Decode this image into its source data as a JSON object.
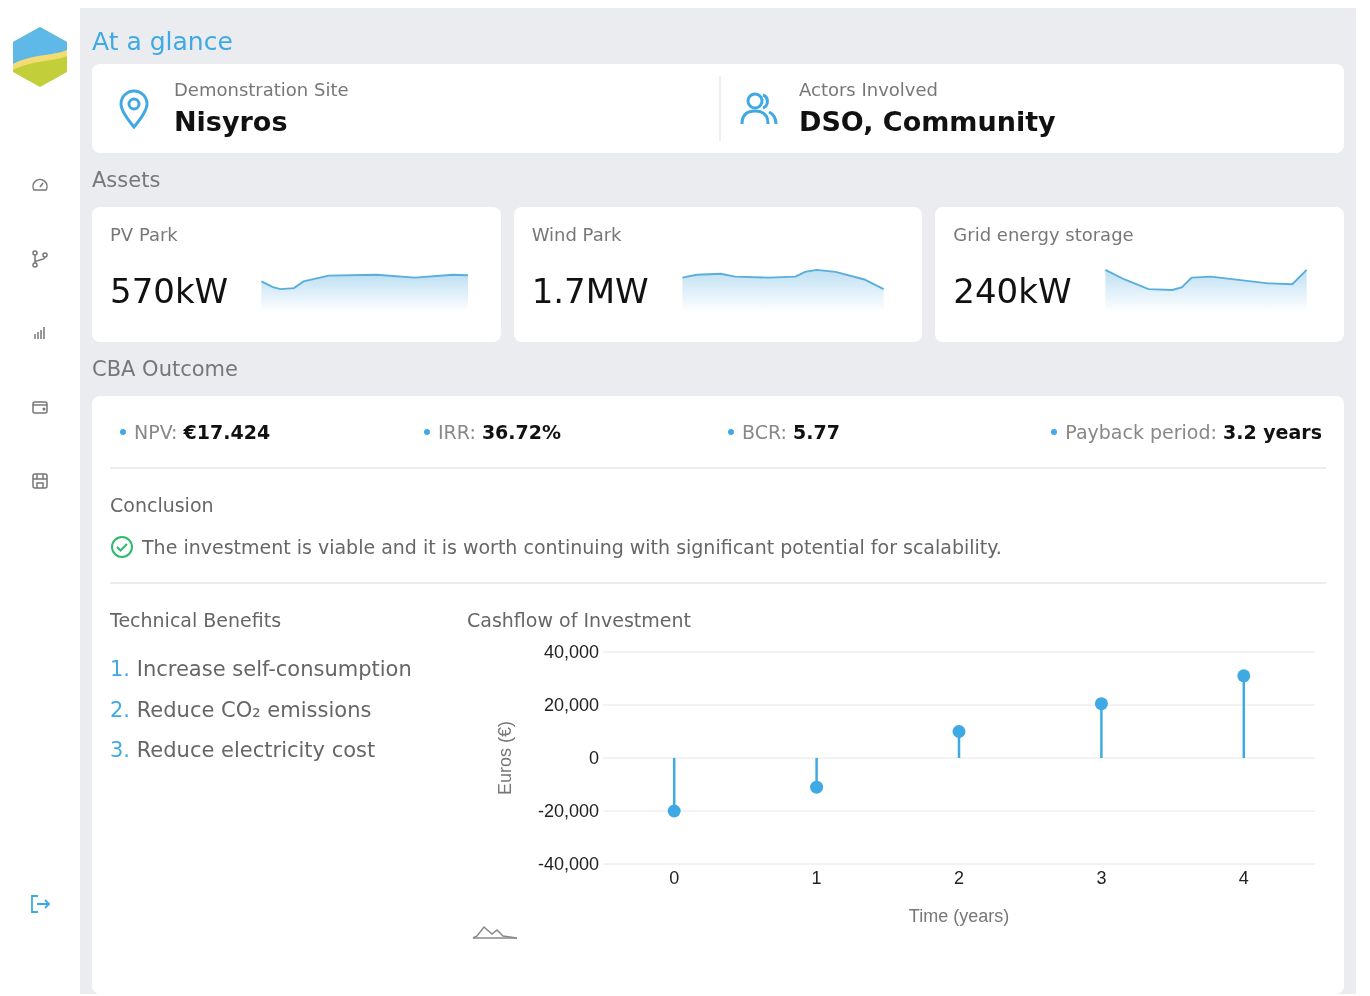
{
  "title": "At a glance",
  "summary": [
    {
      "kind": "location",
      "label": "Demonstration Site",
      "value": "Nisyros"
    },
    {
      "kind": "people",
      "label": "Actors Involved",
      "value": "DSO, Community"
    }
  ],
  "assets": {
    "heading": "Assets",
    "items": [
      {
        "label": "PV Park",
        "value": "570kW"
      },
      {
        "label": "Wind Park",
        "value": "1.7MW"
      },
      {
        "label": "Grid energy storage",
        "value": "240kW"
      }
    ]
  },
  "cba": {
    "heading": "CBA Outcome",
    "metrics": [
      {
        "label": "NPV:",
        "value": "€17.424"
      },
      {
        "label": "IRR:",
        "value": "36.72%"
      },
      {
        "label": "BCR:",
        "value": "5.77"
      },
      {
        "label": "Payback period:",
        "value": "3.2 years"
      }
    ],
    "conclusion_heading": "Conclusion",
    "conclusion": "The investment is viable and it is worth continuing with significant potential for scalability.",
    "benefits_heading": "Technical Benefits",
    "benefits": [
      {
        "number": "1.",
        "text": "Increase self-consumption"
      },
      {
        "number": "2.",
        "text": "Reduce CO₂ emissions"
      },
      {
        "number": "3.",
        "text": "Reduce electricity cost"
      }
    ],
    "chart_title": "Cashflow of Investment",
    "chart_data": {
      "type": "scatter",
      "xlabel": "Time (years)",
      "ylabel": "Euros (€)",
      "x": [
        0,
        1,
        2,
        3,
        4
      ],
      "series": [
        {
          "color": "#3fa9e4",
          "values": [
            -20000,
            -11000,
            10000,
            20500,
            31000
          ]
        }
      ],
      "grid": true,
      "xlim": [
        -0.5,
        4.5
      ],
      "ylim": [
        -40000,
        40000
      ],
      "xticks": [
        0,
        1,
        2,
        3,
        4
      ],
      "yticks": [
        {
          "value": 40000,
          "label": "40,000"
        },
        {
          "value": 20000,
          "label": "20,000"
        },
        {
          "value": 0,
          "label": "0"
        },
        {
          "value": -20000,
          "label": "-20,000"
        },
        {
          "value": -40000,
          "label": "-40,000"
        }
      ]
    }
  }
}
